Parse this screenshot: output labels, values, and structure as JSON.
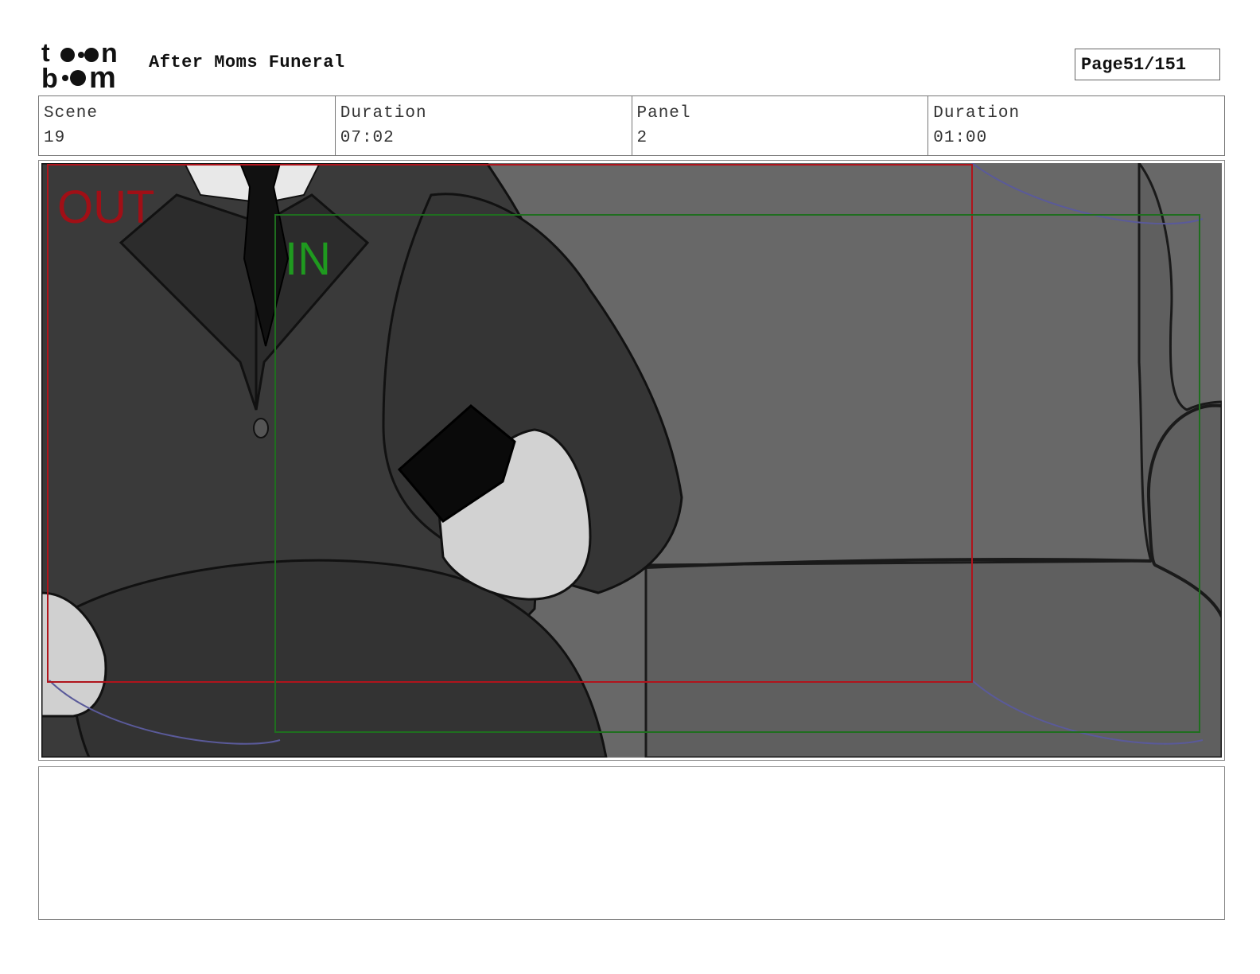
{
  "header": {
    "logo_text_top": "toon",
    "logo_text_bottom": "boom",
    "project_title": "After Moms Funeral",
    "page_label": "Page",
    "page_number": "51/151"
  },
  "info": {
    "scene_label": "Scene",
    "scene_value": "19",
    "scene_duration_label": "Duration",
    "scene_duration_value": "07:02",
    "panel_label": "Panel",
    "panel_value": "2",
    "panel_duration_label": "Duration",
    "panel_duration_value": "01:00"
  },
  "panel": {
    "out_label": "OUT",
    "in_label": "IN",
    "out_color": "#b0141c",
    "in_color": "#1f8a1f"
  },
  "notes": {
    "text": ""
  }
}
